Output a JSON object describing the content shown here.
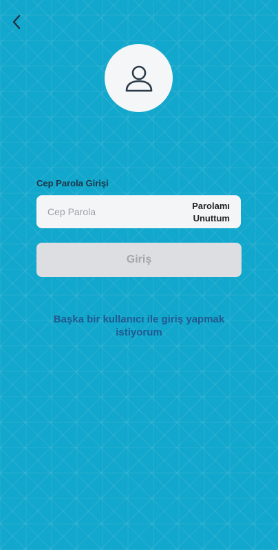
{
  "header": {
    "back_icon": "chevron-left-icon"
  },
  "avatar": {
    "icon": "user-icon"
  },
  "login_form": {
    "field_label": "Cep Parola Girişi",
    "password_placeholder": "Cep Parola",
    "password_value": "",
    "forgot_password_label": "Parolamı Unuttum",
    "submit_label": "Giriş",
    "submit_enabled": false
  },
  "footer": {
    "switch_user_label": "Başka bir kullanıcı ile giriş yapmak istiyorum"
  },
  "colors": {
    "background": "#12a7cc",
    "input_background": "#f4f5f7",
    "button_disabled": "#dcdee1",
    "link": "#1f5a92"
  }
}
